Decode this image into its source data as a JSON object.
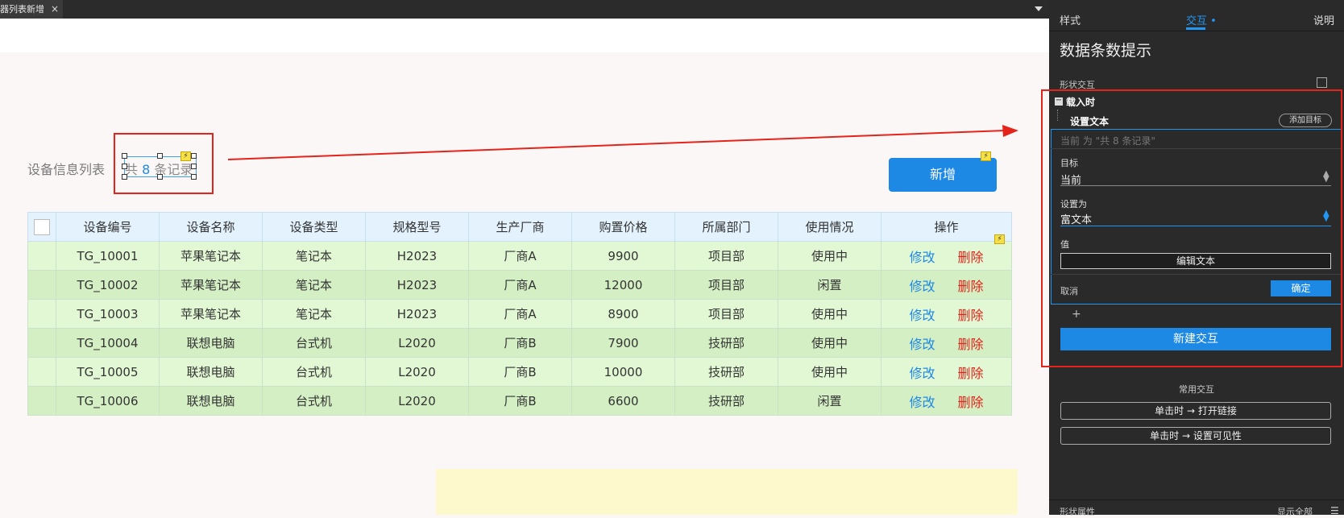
{
  "tab": {
    "title": "器列表新增",
    "close": "×"
  },
  "canvas": {
    "list_title": "设备信息列表",
    "count_prefix": "共 ",
    "count_num": "8",
    "count_suffix": " 条记录",
    "add_button": "新增",
    "lightning": "⚡"
  },
  "table": {
    "headers": [
      "设备编号",
      "设备名称",
      "设备类型",
      "规格型号",
      "生产厂商",
      "购置价格",
      "所属部门",
      "使用情况",
      "操作"
    ],
    "rows": [
      [
        "TG_10001",
        "苹果笔记本",
        "笔记本",
        "H2023",
        "厂商A",
        "9900",
        "项目部",
        "使用中"
      ],
      [
        "TG_10002",
        "苹果笔记本",
        "笔记本",
        "H2023",
        "厂商A",
        "12000",
        "项目部",
        "闲置"
      ],
      [
        "TG_10003",
        "苹果笔记本",
        "笔记本",
        "H2023",
        "厂商A",
        "8900",
        "项目部",
        "使用中"
      ],
      [
        "TG_10004",
        "联想电脑",
        "台式机",
        "L2020",
        "厂商B",
        "7900",
        "技研部",
        "使用中"
      ],
      [
        "TG_10005",
        "联想电脑",
        "台式机",
        "L2020",
        "厂商B",
        "10000",
        "技研部",
        "使用中"
      ],
      [
        "TG_10006",
        "联想电脑",
        "台式机",
        "L2020",
        "厂商B",
        "6600",
        "技研部",
        "闲置"
      ]
    ],
    "op_edit": "修改",
    "op_delete": "删除"
  },
  "panel": {
    "tabs": {
      "style": "样式",
      "interaction": "交互",
      "notes": "说明"
    },
    "title": "数据条数提示",
    "shape_interaction": "形状交互",
    "on_load": "载入时",
    "set_text": "设置文本",
    "add_target": "添加目标",
    "placeholder": "当前 为 \"共 8 条记录\"",
    "target_label": "目标",
    "target_value": "当前",
    "set_as_label": "设置为",
    "set_as_value": "富文本",
    "value_label": "值",
    "edit_text": "编辑文本",
    "cancel": "取消",
    "confirm": "确定",
    "plus": "+",
    "new_interaction": "新建交互",
    "common_interactions": "常用交互",
    "click_open_link": "单击时 → 打开链接",
    "click_set_visibility": "单击时 → 设置可见性",
    "shape_properties": "形状属性",
    "show_all": "显示全部"
  },
  "colors": {
    "accent": "#1e88e5",
    "danger": "#e4231a",
    "annotation": "#e4231a"
  }
}
